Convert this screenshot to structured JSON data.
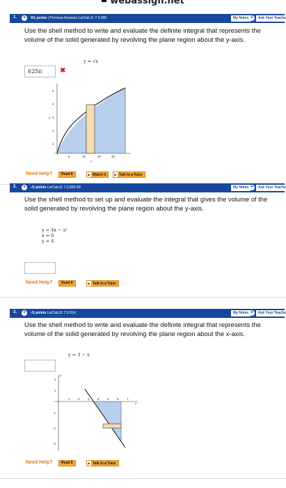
{
  "site": {
    "title": "webassign.net"
  },
  "colors": {
    "header_blue": "#17479e",
    "region_fill": "#b7cfec",
    "shell_fill": "#f5dcad",
    "help_orange": "#e07b12",
    "wrong_red": "#d21f1f"
  },
  "questions": [
    {
      "number": "1.",
      "points": "0/1 points",
      "links": "| Previous Answers LarCalc11 7.3.005.",
      "my_notes": "My Notes",
      "ask_teacher": "Ask Your Teacher",
      "prompt": "Use the shell method to write and evaluate the definite integral that represents the volume of the solid generated by revolving the plane region about the y-axis.",
      "equation": "y = √x",
      "answer": "625π",
      "answer_correct": false,
      "graph": {
        "y_ticks": [
          "5",
          "4",
          "3",
          "2",
          "1"
        ],
        "x_ticks": [
          "5",
          "10",
          "15",
          "20"
        ],
        "x_label": "x",
        "y_label": "y"
      },
      "help_label": "Need Help?",
      "buttons": [
        "Read It",
        "Watch It",
        "Talk to a Tutor"
      ]
    },
    {
      "number": "2.",
      "points": "-/1 points",
      "links": "LarCalc11 7.3.509.XP.",
      "my_notes": "My Notes",
      "ask_teacher": "Ask Your Teacher",
      "prompt": "Use the shell method to set up and evaluate the integral that gives the volume of the solid generated by revolving the plane region about the y-axis.",
      "equations": [
        "y = 4x − x²",
        "x = 0",
        "y = 4"
      ],
      "answer": "",
      "help_label": "Need Help?",
      "buttons": [
        "Read It",
        "Talk to a Tutor"
      ]
    },
    {
      "number": "3.",
      "points": "-/1 points",
      "links": "LarCalc11 7.3.014.",
      "my_notes": "My Notes",
      "ask_teacher": "Ask Your Teacher",
      "prompt": "Use the shell method to write and evaluate the definite integral that represents the volume of the solid generated by revolving the plane region about the x-axis.",
      "equation": "y = 3 − x",
      "answer": "",
      "graph": {
        "x_ticks": [
          "1",
          "2",
          "3",
          "4",
          "5",
          "6",
          "7"
        ],
        "y_ticks": [
          "2",
          "1",
          "-1",
          "-2",
          "-3"
        ],
        "x_label": "x",
        "y_label": "y"
      },
      "help_label": "Need Help?",
      "buttons": [
        "Read It",
        "Talk to a Tutor"
      ]
    }
  ]
}
